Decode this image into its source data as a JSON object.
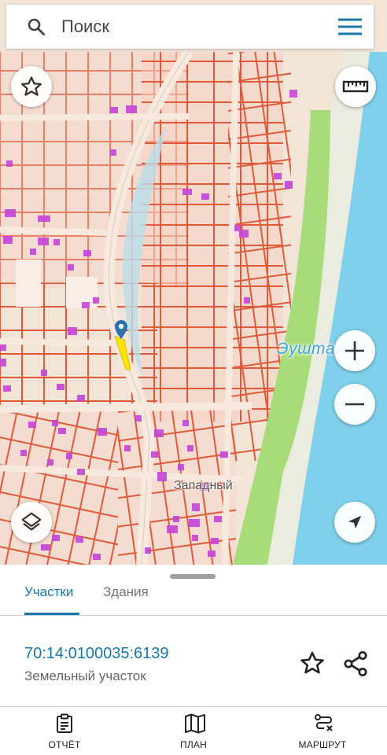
{
  "search": {
    "placeholder": "Поиск"
  },
  "map": {
    "river_label": "Эушта",
    "district_label": "Западный",
    "colors": {
      "land": "#f1e3d6",
      "parcel_stroke": "#e05a3a",
      "building": "#c545d8",
      "river": "#7fd0ea",
      "park": "#9fd572",
      "marker": "#2a71b2",
      "selection": "#ffe600"
    }
  },
  "tabs": [
    {
      "label": "Участки",
      "active": true
    },
    {
      "label": "Здания",
      "active": false
    }
  ],
  "parcel": {
    "cadastral_number": "70:14:0100035:6139",
    "type": "Земельный участок"
  },
  "nav": [
    {
      "label": "ОТЧЁТ",
      "icon": "report-icon"
    },
    {
      "label": "ПЛАН",
      "icon": "map-plan-icon"
    },
    {
      "label": "МАРШРУТ",
      "icon": "route-icon"
    }
  ],
  "icons": [
    "search-icon",
    "menu-icon",
    "star-icon",
    "ruler-icon",
    "zoom-in-icon",
    "zoom-out-icon",
    "layers-icon",
    "locate-icon",
    "share-icon",
    "map-pin-icon"
  ]
}
